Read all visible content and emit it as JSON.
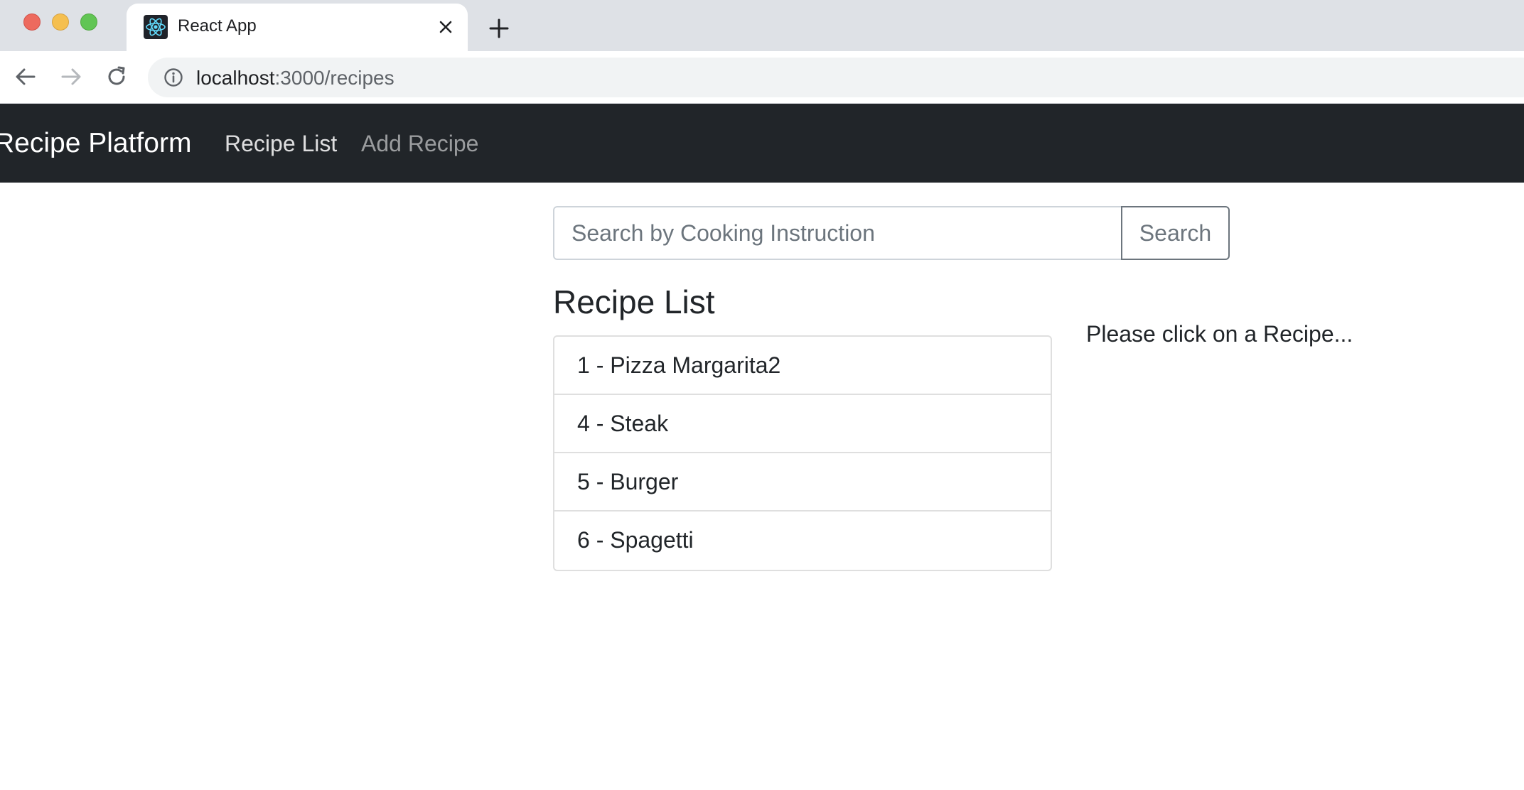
{
  "browser": {
    "tab": {
      "title": "React App",
      "favicon_icon": "react-logo-icon"
    },
    "address_bar": {
      "url_host": "localhost",
      "url_rest": ":3000/recipes"
    },
    "colors": {
      "tabstrip_bg": "#dee1e6",
      "close": "#ed6a5e",
      "minimize": "#f5bf4f",
      "maximize": "#61c554"
    }
  },
  "navbar": {
    "brand": "Recipe Platform",
    "links": [
      {
        "label": "Recipe List",
        "active": true
      },
      {
        "label": "Add Recipe",
        "active": false
      }
    ],
    "bg_color": "#212529"
  },
  "search": {
    "placeholder": "Search by Cooking Instruction",
    "value": "",
    "button_label": "Search"
  },
  "main": {
    "heading": "Recipe List",
    "recipes": [
      {
        "label": "1 - Pizza Margarita2"
      },
      {
        "label": "4 - Steak"
      },
      {
        "label": "5 - Burger"
      },
      {
        "label": "6 - Spagetti"
      }
    ],
    "hint": "Please click on a Recipe..."
  }
}
